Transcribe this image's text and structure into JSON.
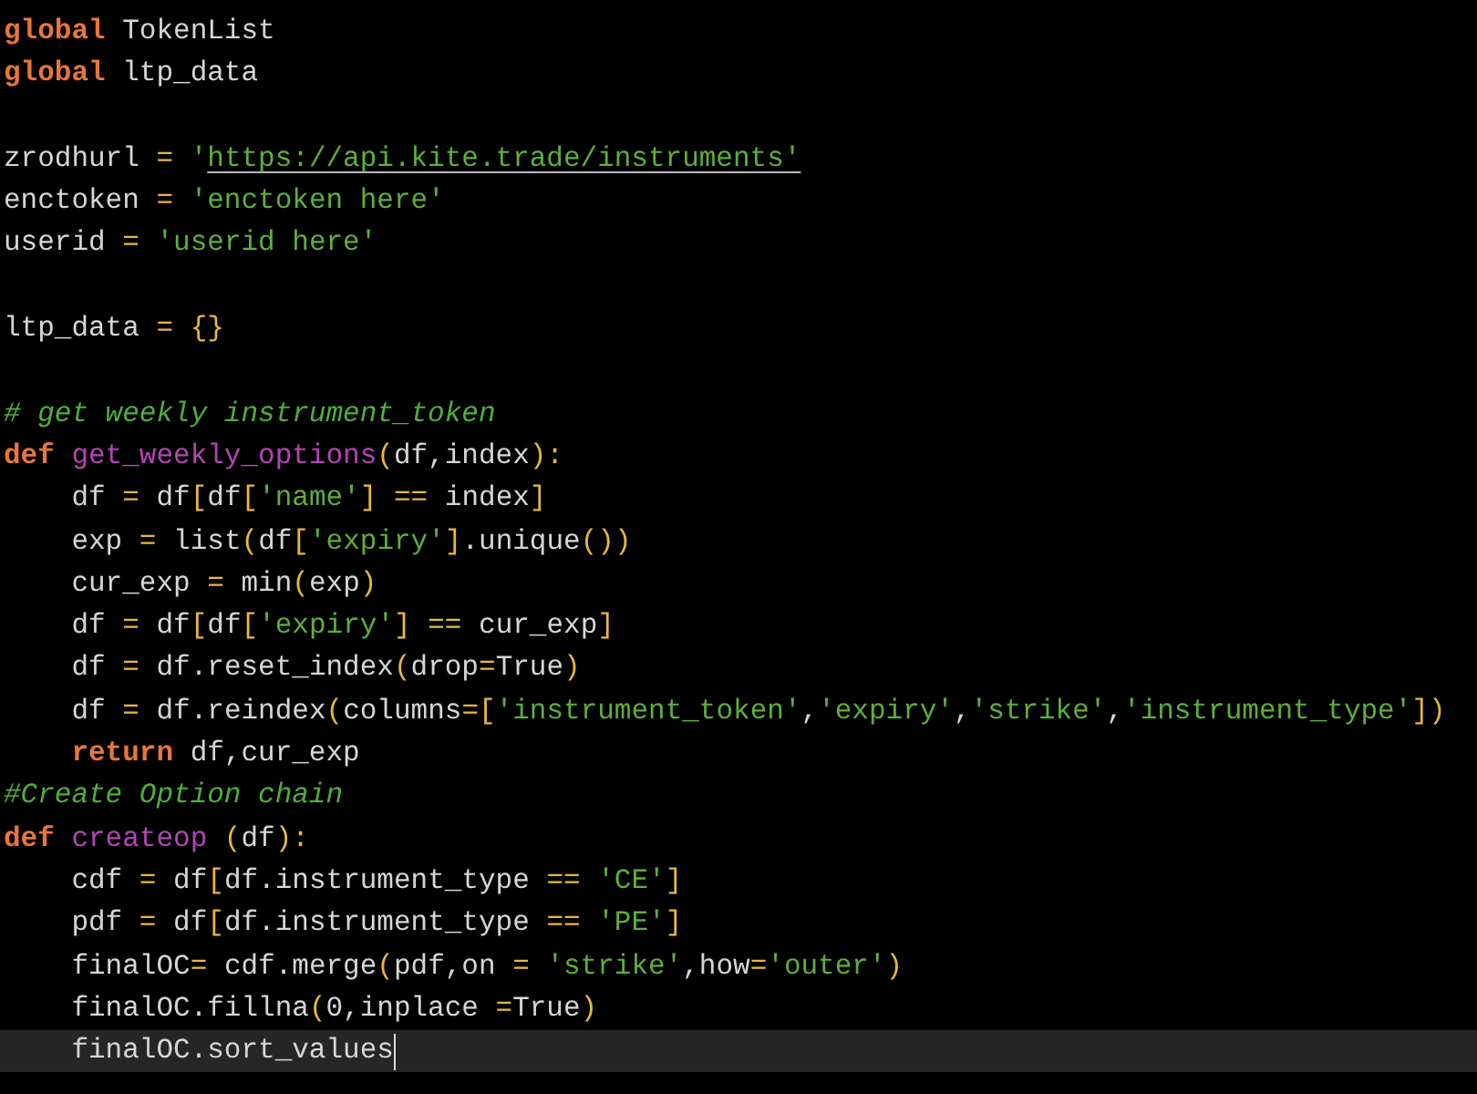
{
  "editor": {
    "lines": [
      {
        "current": false,
        "tokens": [
          {
            "kind": "kw",
            "text": "global"
          },
          {
            "kind": "plain",
            "text": " TokenList"
          }
        ]
      },
      {
        "current": false,
        "tokens": [
          {
            "kind": "kw",
            "text": "global"
          },
          {
            "kind": "plain",
            "text": " ltp_data"
          }
        ]
      },
      {
        "current": false
      },
      {
        "current": false,
        "tokens": [
          {
            "kind": "plain",
            "text": "zrodhurl "
          },
          {
            "kind": "op",
            "text": "="
          },
          {
            "kind": "str",
            "text": " '"
          },
          {
            "kind": "url",
            "text": "https://api.kite.trade/instruments'"
          }
        ]
      },
      {
        "current": false,
        "tokens": [
          {
            "kind": "plain",
            "text": "enctoken "
          },
          {
            "kind": "op",
            "text": "="
          },
          {
            "kind": "str",
            "text": " 'enctoken here'"
          }
        ]
      },
      {
        "current": false,
        "tokens": [
          {
            "kind": "plain",
            "text": "userid "
          },
          {
            "kind": "op",
            "text": "="
          },
          {
            "kind": "str",
            "text": " 'userid here'"
          }
        ]
      },
      {
        "current": false
      },
      {
        "current": false,
        "tokens": [
          {
            "kind": "plain",
            "text": "ltp_data "
          },
          {
            "kind": "op",
            "text": "= {}"
          }
        ]
      },
      {
        "current": false
      },
      {
        "current": false,
        "tokens": [
          {
            "kind": "cmt",
            "text": "# get weekly instrument_token"
          }
        ]
      },
      {
        "current": false,
        "tokens": [
          {
            "kind": "kw",
            "text": "def"
          },
          {
            "kind": "fn",
            "text": " get_weekly_options"
          },
          {
            "kind": "op",
            "text": "("
          },
          {
            "kind": "plain",
            "text": "df,index"
          },
          {
            "kind": "op",
            "text": "):"
          }
        ]
      },
      {
        "current": false,
        "tokens": [
          {
            "kind": "plain",
            "text": "    df "
          },
          {
            "kind": "op",
            "text": "="
          },
          {
            "kind": "plain",
            "text": " df"
          },
          {
            "kind": "op",
            "text": "["
          },
          {
            "kind": "plain",
            "text": "df"
          },
          {
            "kind": "op",
            "text": "["
          },
          {
            "kind": "str",
            "text": "'name'"
          },
          {
            "kind": "op",
            "text": "] =="
          },
          {
            "kind": "plain",
            "text": " index"
          },
          {
            "kind": "op",
            "text": "]"
          }
        ]
      },
      {
        "current": false,
        "tokens": [
          {
            "kind": "plain",
            "text": "    exp "
          },
          {
            "kind": "op",
            "text": "="
          },
          {
            "kind": "plain",
            "text": " list"
          },
          {
            "kind": "op",
            "text": "("
          },
          {
            "kind": "plain",
            "text": "df"
          },
          {
            "kind": "op",
            "text": "["
          },
          {
            "kind": "str",
            "text": "'expiry'"
          },
          {
            "kind": "op",
            "text": "]"
          },
          {
            "kind": "plain",
            "text": ".unique"
          },
          {
            "kind": "op",
            "text": "())"
          }
        ]
      },
      {
        "current": false,
        "tokens": [
          {
            "kind": "plain",
            "text": "    cur_exp "
          },
          {
            "kind": "op",
            "text": "="
          },
          {
            "kind": "plain",
            "text": " min"
          },
          {
            "kind": "op",
            "text": "("
          },
          {
            "kind": "plain",
            "text": "exp"
          },
          {
            "kind": "op",
            "text": ")"
          }
        ]
      },
      {
        "current": false,
        "tokens": [
          {
            "kind": "plain",
            "text": "    df "
          },
          {
            "kind": "op",
            "text": "="
          },
          {
            "kind": "plain",
            "text": " df"
          },
          {
            "kind": "op",
            "text": "["
          },
          {
            "kind": "plain",
            "text": "df"
          },
          {
            "kind": "op",
            "text": "["
          },
          {
            "kind": "str",
            "text": "'expiry'"
          },
          {
            "kind": "op",
            "text": "] =="
          },
          {
            "kind": "plain",
            "text": " cur_exp"
          },
          {
            "kind": "op",
            "text": "]"
          }
        ]
      },
      {
        "current": false,
        "tokens": [
          {
            "kind": "plain",
            "text": "    df "
          },
          {
            "kind": "op",
            "text": "="
          },
          {
            "kind": "plain",
            "text": " df.reset_index"
          },
          {
            "kind": "op",
            "text": "("
          },
          {
            "kind": "plain",
            "text": "drop"
          },
          {
            "kind": "op",
            "text": "="
          },
          {
            "kind": "plain",
            "text": "True"
          },
          {
            "kind": "op",
            "text": ")"
          }
        ]
      },
      {
        "current": false,
        "tokens": [
          {
            "kind": "plain",
            "text": "    df "
          },
          {
            "kind": "op",
            "text": "="
          },
          {
            "kind": "plain",
            "text": " df.reindex"
          },
          {
            "kind": "op",
            "text": "("
          },
          {
            "kind": "plain",
            "text": "columns"
          },
          {
            "kind": "op",
            "text": "=["
          },
          {
            "kind": "str",
            "text": "'instrument_token'"
          },
          {
            "kind": "plain",
            "text": ","
          },
          {
            "kind": "str",
            "text": "'expiry'"
          },
          {
            "kind": "plain",
            "text": ","
          },
          {
            "kind": "str",
            "text": "'strike'"
          },
          {
            "kind": "plain",
            "text": ","
          },
          {
            "kind": "str",
            "text": "'instrument_type'"
          },
          {
            "kind": "op",
            "text": "])"
          }
        ]
      },
      {
        "current": false,
        "tokens": [
          {
            "kind": "kw",
            "text": "    return"
          },
          {
            "kind": "plain",
            "text": " df,cur_exp"
          }
        ]
      },
      {
        "current": false,
        "tokens": [
          {
            "kind": "cmt",
            "text": "#Create Option chain"
          }
        ]
      },
      {
        "current": false,
        "tokens": [
          {
            "kind": "kw",
            "text": "def"
          },
          {
            "kind": "fn",
            "text": " createop"
          },
          {
            "kind": "op",
            "text": " ("
          },
          {
            "kind": "plain",
            "text": "df"
          },
          {
            "kind": "op",
            "text": "):"
          }
        ]
      },
      {
        "current": false,
        "tokens": [
          {
            "kind": "plain",
            "text": "    cdf "
          },
          {
            "kind": "op",
            "text": "="
          },
          {
            "kind": "plain",
            "text": " df"
          },
          {
            "kind": "op",
            "text": "["
          },
          {
            "kind": "plain",
            "text": "df.instrument_type "
          },
          {
            "kind": "op",
            "text": "=="
          },
          {
            "kind": "str",
            "text": " 'CE'"
          },
          {
            "kind": "op",
            "text": "]"
          }
        ]
      },
      {
        "current": false,
        "tokens": [
          {
            "kind": "plain",
            "text": "    pdf "
          },
          {
            "kind": "op",
            "text": "="
          },
          {
            "kind": "plain",
            "text": " df"
          },
          {
            "kind": "op",
            "text": "["
          },
          {
            "kind": "plain",
            "text": "df.instrument_type "
          },
          {
            "kind": "op",
            "text": "=="
          },
          {
            "kind": "str",
            "text": " 'PE'"
          },
          {
            "kind": "op",
            "text": "]"
          }
        ]
      },
      {
        "current": false,
        "tokens": [
          {
            "kind": "plain",
            "text": "    finalOC"
          },
          {
            "kind": "op",
            "text": "="
          },
          {
            "kind": "plain",
            "text": " cdf.merge"
          },
          {
            "kind": "op",
            "text": "("
          },
          {
            "kind": "plain",
            "text": "pdf,on "
          },
          {
            "kind": "op",
            "text": "="
          },
          {
            "kind": "str",
            "text": " 'strike'"
          },
          {
            "kind": "plain",
            "text": ",how"
          },
          {
            "kind": "op",
            "text": "="
          },
          {
            "kind": "str",
            "text": "'outer'"
          },
          {
            "kind": "op",
            "text": ")"
          }
        ]
      },
      {
        "current": false,
        "tokens": [
          {
            "kind": "plain",
            "text": "    finalOC.fillna"
          },
          {
            "kind": "op",
            "text": "("
          },
          {
            "kind": "plain",
            "text": "0,inplace "
          },
          {
            "kind": "op",
            "text": "="
          },
          {
            "kind": "plain",
            "text": "True"
          },
          {
            "kind": "op",
            "text": ")"
          }
        ]
      },
      {
        "current": true,
        "tokens": [
          {
            "kind": "plain",
            "text": "    finalOC.sort_values"
          }
        ]
      }
    ]
  }
}
